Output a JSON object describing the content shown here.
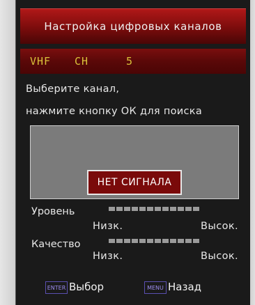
{
  "title": "Настройка цифровых каналов",
  "channel": {
    "band": "VHF",
    "label": "CH",
    "number": "5"
  },
  "instructions": {
    "line1": "Выберите канал,",
    "line2": "нажмите кнопку ОК для поиска"
  },
  "status": "НЕТ СИГНАЛА",
  "level": {
    "label": "Уровень",
    "low": "Низк.",
    "high": "Высок.",
    "segments": 12,
    "value": 0
  },
  "quality": {
    "label": "Качество",
    "low": "Низк.",
    "high": "Высок.",
    "segments": 12,
    "value": 0
  },
  "keys": {
    "enter_key": "ENTER",
    "enter_action": "Выбор",
    "menu_key": "MENU",
    "menu_action": "Назад"
  },
  "colors": {
    "title_bar": "#9a1010",
    "channel_text": "#d9c23a",
    "status_bg": "#7a0a0a",
    "key_text": "#9d8df0",
    "meter_segment": "#9a9a9a"
  }
}
